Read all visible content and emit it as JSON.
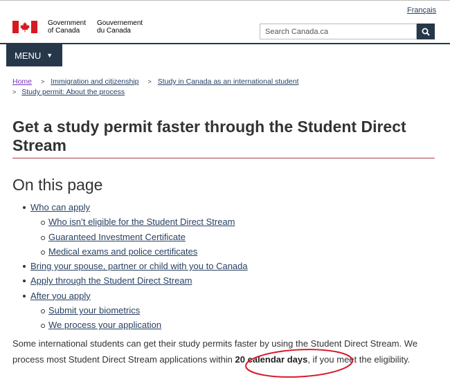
{
  "header": {
    "language_toggle": "Français",
    "wordmark_en_line1": "Government",
    "wordmark_en_line2": "of Canada",
    "wordmark_fr_line1": "Gouvernement",
    "wordmark_fr_line2": "du Canada",
    "search_placeholder": "Search Canada.ca",
    "search_icon": "search-icon",
    "menu_label": "MENU"
  },
  "breadcrumb": {
    "items": [
      "Home",
      "Immigration and citizenship",
      "Study in Canada as an international student",
      "Study permit: About the process"
    ]
  },
  "page": {
    "title": "Get a study permit faster through the Student Direct Stream",
    "toc_heading": "On this page",
    "toc": [
      {
        "label": "Who can apply",
        "level": 1
      },
      {
        "label": "Who isn’t eligible for the Student Direct Stream",
        "level": 2
      },
      {
        "label": "Guaranteed Investment Certificate",
        "level": 2
      },
      {
        "label": "Medical exams and police certificates",
        "level": 2
      },
      {
        "label": "Bring your spouse, partner or child with you to Canada",
        "level": 1
      },
      {
        "label": "Apply through the Student Direct Stream",
        "level": 1
      },
      {
        "label": "After you apply",
        "level": 1
      },
      {
        "label": "Submit your biometrics",
        "level": 2
      },
      {
        "label": "We process your application",
        "level": 2
      }
    ],
    "intro_part1": "Some international students can get their study permits faster by using the Student Direct Stream. We process most Student Direct Stream applications within ",
    "intro_bold": "20 calendar days",
    "intro_part2": ", if you meet the eligibility."
  },
  "colors": {
    "brand_dark": "#26374a",
    "link": "#284162",
    "visited_link": "#7834bc",
    "flag_red": "#d71920",
    "title_rule": "#af3c43",
    "annotation_red": "#d8192b"
  }
}
